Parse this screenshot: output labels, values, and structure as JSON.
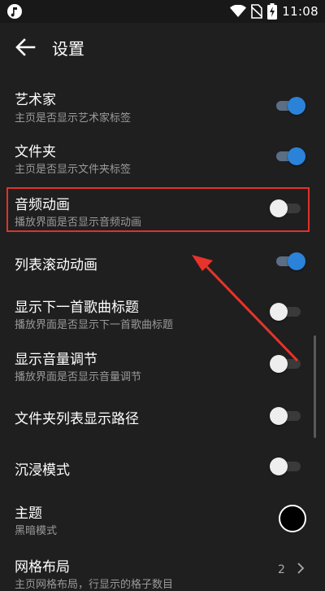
{
  "status": {
    "time": "11:08"
  },
  "header": {
    "title": "设置"
  },
  "settings": [
    {
      "title": "艺术家",
      "subtitle": "主页是否显示艺术家标签",
      "state": "on"
    },
    {
      "title": "文件夹",
      "subtitle": "主页是否显示文件夹标签",
      "state": "on"
    },
    {
      "title": "音频动画",
      "subtitle": "播放界面是否显示音频动画",
      "state": "off"
    },
    {
      "title": "列表滚动动画",
      "subtitle": "",
      "state": "on"
    },
    {
      "title": "显示下一首歌曲标题",
      "subtitle": "播放界面是否显示下一首歌曲标题",
      "state": "off"
    },
    {
      "title": "显示音量调节",
      "subtitle": "播放界面是否显示音量调节",
      "state": "off"
    },
    {
      "title": "文件夹列表显示路径",
      "subtitle": "",
      "state": "off"
    },
    {
      "title": "沉浸模式",
      "subtitle": "",
      "state": "off"
    },
    {
      "title": "主题",
      "subtitle": "黑暗模式"
    },
    {
      "title": "网格布局",
      "subtitle": "主页网格布局，行显示的格子数目",
      "value": "2"
    }
  ],
  "colors": {
    "accent": "#2b82d9",
    "highlight_border": "#e0322b",
    "background": "#1f1f1f"
  },
  "icons": [
    "music-app-icon",
    "wifi-icon",
    "no-sim-icon",
    "battery-charging-icon",
    "back-arrow-icon",
    "chevron-right-icon",
    "red-pointer-arrow"
  ]
}
